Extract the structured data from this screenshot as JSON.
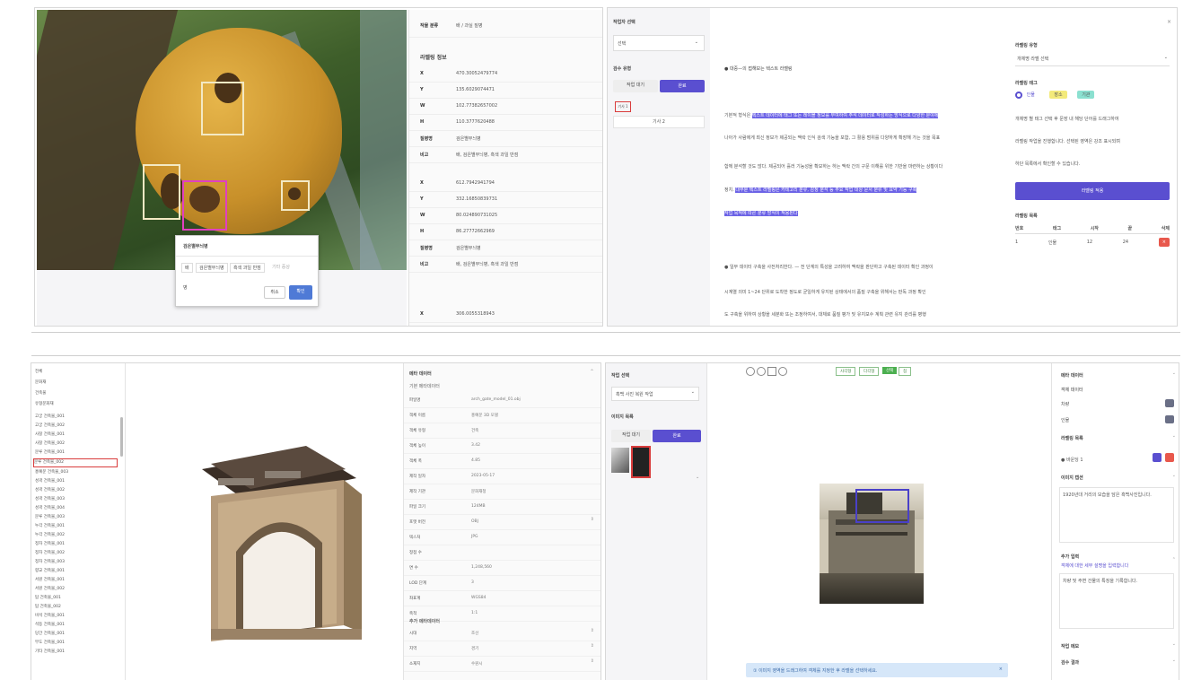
{
  "colors": {
    "accent": "#5a4fd0",
    "highlight": "#6c63e6",
    "danger": "#e8584c",
    "selection_magenta": "#e040c0",
    "bbox_cream": "#f3e9c4",
    "selected_red": "#d93c3c"
  },
  "panel1": {
    "popup": {
      "title": "검은별무늬병",
      "chips": [
        "배",
        "검은별무늬병",
        "흑색 과일 반점",
        "기타 증상"
      ],
      "input_value": "병",
      "cancel_label": "취소",
      "confirm_label": "확인"
    },
    "info": {
      "top_key": "작물 분류",
      "top_val": "배 / 과실 질병",
      "section_title": "라벨링 정보",
      "rows1": [
        {
          "k": "X",
          "v": "470.30052479774"
        },
        {
          "k": "Y",
          "v": "135.6029074471"
        },
        {
          "k": "W",
          "v": "102.77382657002"
        },
        {
          "k": "H",
          "v": "110.3777620488"
        },
        {
          "k": "질병명",
          "v": "검은별무늬병"
        },
        {
          "k": "비고",
          "v": "배, 검은별무늬병, 흑색 과일 반점"
        }
      ],
      "rows2": [
        {
          "k": "X",
          "v": "612.7942941794"
        },
        {
          "k": "Y",
          "v": "332.16850839731"
        },
        {
          "k": "W",
          "v": "80.024890731025"
        },
        {
          "k": "H",
          "v": "86.27772662969"
        },
        {
          "k": "질병명",
          "v": "검은별무늬병"
        },
        {
          "k": "비고",
          "v": "배, 검은별무늬병, 흑색 과일 반점"
        }
      ],
      "last_row": {
        "k": "X",
        "v": "306.0055318943"
      }
    }
  },
  "panel2": {
    "left": {
      "section1": "작업자 선택",
      "select_value": "선택",
      "section2": "검수 유형",
      "tab_inactive": "작업 대기",
      "tab_active": "완료",
      "selected_item": "기사 1",
      "item2": "기사 2"
    },
    "text": {
      "heading": "● 대중—의 접해보는 텍스트 라벨링",
      "l1_pre": "기본적 형식은 ",
      "l1_hl": "텍스트 데이터에 태그 또는 레이블 정보를 부여하여 주석 데이터로 작성하는 방식으로 다양한 분야에",
      "l2": "나아가 사람에게 최신 정보가 제공되는 맥락 인식 검색 기능을 포함, 그 활용 범위를 다양하게 확장해 가는 것을 목표",
      "l3": "함께 분석할 것도 많다. 제공되어 흘러 기능성을 확보하는 하는 맥락 간의 구문 이해를 위한 기반을 마련하는 상황이다",
      "l4_pre": "정치. ",
      "l4_hl": "대부분 텍스트 라벨링은 카테고리 분류, 감정 분석 등 주요 작업 대상 문서 분류 및 요약 기능 구축",
      "l5_hl": "작업 목적에 따른 분류 방식이 적용된다",
      "heading2": "● 일부 대체로 구분된 사전처리",
      "p2_l1": "● 일부 데이터 구축을 사전처리한다. — 전 단계의 특성을 고려하여 맥락을 판단하고 구축된 데이터 확인 과정이",
      "p2_l2": "시계열 의미 1~24 단위로 도착한 정도로 균일하게 유지된 상태에서의 품질 구축을 위해서는 판독 과정 확인",
      "p2_l3": "도 구축을 위하여 상황을 세분화 또는 조정하여서, 대체로 품질 평가 및 유지보수 계획 관련 유지 관리를 병행"
    },
    "right": {
      "sec1": "라벨링 유형",
      "select1": "개체명 라벨 선택",
      "sec2": "라벨링 태그",
      "tags": [
        "인물",
        "장소",
        "기관"
      ],
      "desc1": "개체명 별 태그 선택 후 문장 내 해당 단어를 드래그하여",
      "desc2": "라벨링 작업을 진행합니다. 선택된 영역은 강조 표시되며",
      "desc3": "하단 목록에서 확인할 수 있습니다.",
      "apply_label": "라벨링 적용",
      "table_title": "라벨링 목록",
      "thead": [
        "번호",
        "태그",
        "시작",
        "끝",
        "삭제"
      ],
      "trow": [
        "1",
        "인물",
        "12",
        "24",
        "×"
      ]
    }
  },
  "panel3": {
    "tree_top": [
      "전체",
      "문화재",
      "건축물",
      "유형문화재"
    ],
    "tree_items": [
      "고궁 건축물_001",
      "고궁 건축물_002",
      "사찰 건축물_001",
      "사찰 건축물_002",
      "문루 건축물_001",
      "문루 건축물_002",
      "홍예문 건축물_003",
      "성곽 건축물_001",
      "성곽 건축물_002",
      "성곽 건축물_003",
      "성곽 건축물_004",
      "문루 건축물_003",
      "누각 건축물_001",
      "누각 건축물_002",
      "정자 건축물_001",
      "정자 건축물_002",
      "정자 건축물_003",
      "향교 건축물_001",
      "서원 건축물_001",
      "서원 건축물_002",
      "탑 건축물_001",
      "탑 건축물_002",
      "비석 건축물_001",
      "석등 건축물_001",
      "당간 건축물_001",
      "부도 건축물_001",
      "기타 건축물_001"
    ],
    "props_title": "메타 데이터",
    "props_sub": "기본 메타데이터",
    "props": [
      {
        "k": "파일명",
        "v": "arch_gate_model_01.obj"
      },
      {
        "k": "객체 이름",
        "v": "홍예문 3D 모델"
      },
      {
        "k": "객체 유형",
        "v": "건축"
      },
      {
        "k": "객체 높이",
        "v": "3.42"
      },
      {
        "k": "객체 폭",
        "v": "4.85"
      },
      {
        "k": "제작 일자",
        "v": "2023-05-17"
      },
      {
        "k": "제작 기관",
        "v": "문화재청"
      },
      {
        "k": "파일 크기",
        "v": "124MB"
      },
      {
        "k": "포맷 버전",
        "v": "OBJ"
      },
      {
        "k": "텍스처",
        "v": "JPG"
      },
      {
        "k": "정점 수",
        "v": ""
      },
      {
        "k": "면 수",
        "v": "1,248,560"
      },
      {
        "k": "LOD 단계",
        "v": "3"
      },
      {
        "k": "좌표계",
        "v": "WGS84"
      },
      {
        "k": "축척",
        "v": "1:1"
      }
    ],
    "section2": "추가 메타데이터",
    "props2": [
      {
        "k": "시대",
        "v": "조선"
      },
      {
        "k": "지역",
        "v": "경기"
      },
      {
        "k": "소재지",
        "v": "수원시"
      }
    ]
  },
  "panel4": {
    "left": {
      "sec1": "작업 선택",
      "select": "흑백 사진 복원 작업",
      "sec2": "이미지 목록",
      "tab_inactive": "작업 대기",
      "tab_active": "완료"
    },
    "toolbar": {
      "tools": [
        "사각형",
        "다각형",
        "선택",
        "점"
      ],
      "zoom_icons": [
        "zoom-in-icon",
        "zoom-out-icon",
        "fit-icon",
        "rotate-icon"
      ]
    },
    "toast": "① 이미지 영역을 드래그하여 객체를 지정한 후 라벨을 선택하세요.",
    "right": {
      "sec1": "메타 데이터",
      "sub1": "객체 데이터",
      "r1": "차량",
      "r2": "인물",
      "sec2": "라벨링 목록",
      "item": "● 바운딩 1",
      "sec3": "이미지 캡션",
      "caption": "1920년대 거리의 모습을 담은 흑백사진입니다.",
      "sec4": "추가 입력",
      "sec4_sub": "객체에 대한 세부 설명을 입력합니다",
      "sec4_text": "차량 및 주변 건물의 특징을 기록합니다.",
      "sec5": "작업 메모",
      "sec6": "검수 결과"
    }
  }
}
